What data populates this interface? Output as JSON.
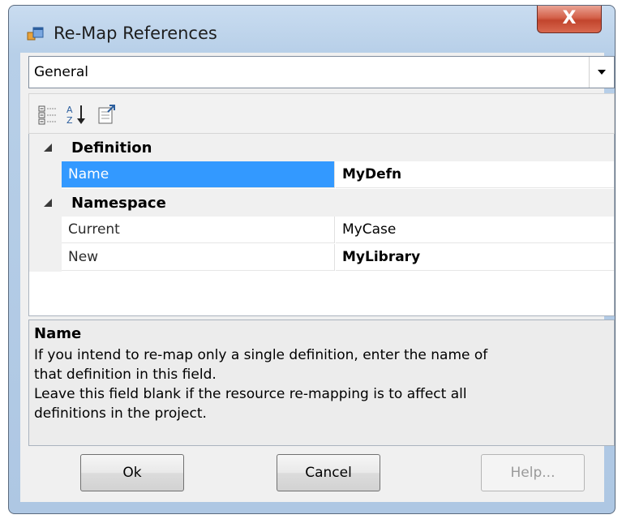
{
  "window": {
    "title": "Re-Map References",
    "close_label": "X"
  },
  "category_select": {
    "value": "General"
  },
  "toolbar": {
    "icons": [
      "categorized-icon",
      "alphabetical-sort-icon",
      "property-pages-icon"
    ]
  },
  "grid": {
    "categories": [
      {
        "label": "Definition"
      },
      {
        "label": "Namespace"
      }
    ],
    "properties": [
      {
        "name": "Name",
        "value": "MyDefn"
      },
      {
        "name": "Current",
        "value": "MyCase"
      },
      {
        "name": "New",
        "value": "MyLibrary"
      }
    ]
  },
  "help": {
    "title": "Name",
    "line1": "If you intend to re-map only a single definition, enter the name of",
    "line2": "that definition in this field.",
    "line3": "Leave this field blank if the resource re-mapping is to affect all",
    "line4": "definitions in the project."
  },
  "buttons": {
    "ok": "Ok",
    "cancel": "Cancel",
    "help": "Help..."
  },
  "colors": {
    "selection": "#3399ff",
    "close": "#c2452d"
  }
}
